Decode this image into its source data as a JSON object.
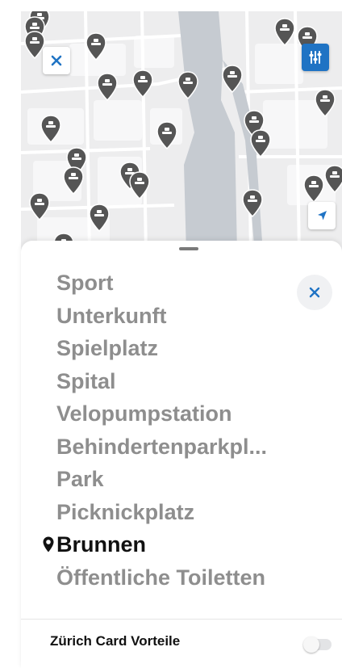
{
  "colors": {
    "accent": "#1f73c4",
    "marker": "#555555",
    "active_text": "#111111",
    "inactive_text": "#8e8e8e",
    "water": "#c6cbd1"
  },
  "map": {
    "close_icon": "close-icon",
    "filter_icon": "filter-sliders-icon",
    "locate_icon": "location-arrow-icon",
    "marker_icon": "fountain-icon"
  },
  "sheet": {
    "close_icon": "close-icon",
    "categories": [
      {
        "label": "Sport",
        "active": false
      },
      {
        "label": "Unterkunft",
        "active": false
      },
      {
        "label": "Spielplatz",
        "active": false
      },
      {
        "label": "Spital",
        "active": false
      },
      {
        "label": "Velopumpstation",
        "active": false
      },
      {
        "label": "Behindertenparkpl...",
        "active": false
      },
      {
        "label": "Park",
        "active": false
      },
      {
        "label": "Picknickplatz",
        "active": false
      },
      {
        "label": "Brunnen",
        "active": true
      },
      {
        "label": "Öffentliche Toiletten",
        "active": false
      }
    ],
    "zurich_card_label": "Zürich Card Vorteile",
    "zurich_card_toggle_on": false
  }
}
